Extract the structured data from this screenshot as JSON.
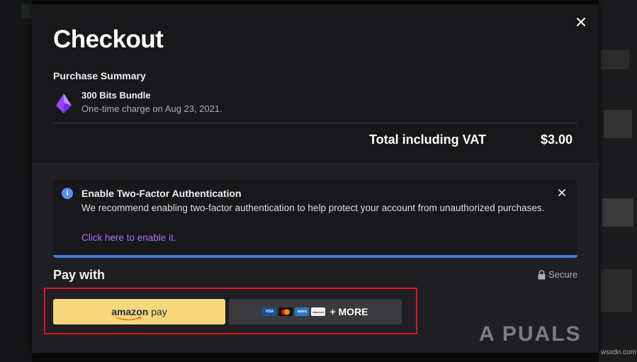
{
  "modal": {
    "title": "Checkout",
    "summary_label": "Purchase Summary",
    "item": {
      "name": "300 Bits Bundle",
      "description": "One-time charge on Aug 23, 2021.",
      "icon": "bits-gem-icon"
    },
    "total_label": "Total including VAT",
    "total_value": "$3.00"
  },
  "alert": {
    "title": "Enable Two-Factor Authentication",
    "body": "We recommend enabling two-factor authentication to help protect your account from unauthorized purchases.",
    "link": "Click here to enable it."
  },
  "payment": {
    "label": "Pay with",
    "secure": "Secure",
    "amazon_word": "amazon",
    "amazon_pay": "pay",
    "more_label": "+ MORE",
    "cards": [
      "VISA",
      "mastercard",
      "amex",
      "discover"
    ]
  },
  "watermark": {
    "text": "A PUALS",
    "small": "wsxdn.com"
  },
  "colors": {
    "accent_purple": "#a970ff",
    "alert_bar": "#3f7be0",
    "amazon_yellow": "#f7d77c",
    "highlight_red": "#e0141a"
  }
}
